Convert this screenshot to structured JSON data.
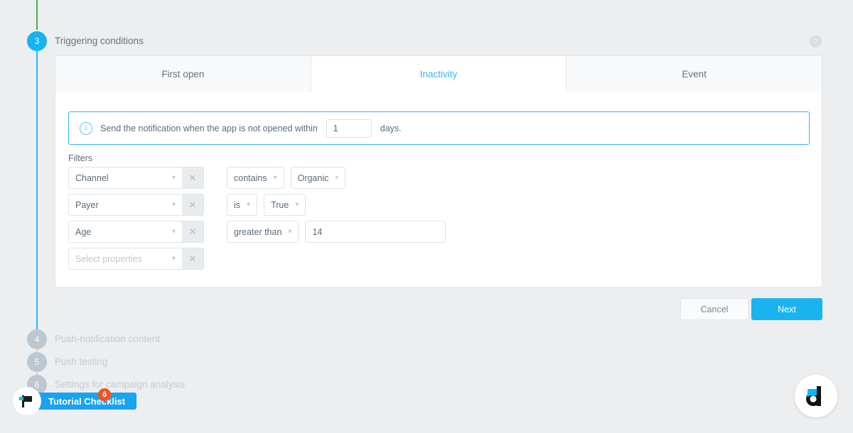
{
  "section": {
    "step_number": "3",
    "title": "Triggering conditions",
    "help_icon": "question-mark-icon"
  },
  "tabs": [
    {
      "label": "First open",
      "active": false
    },
    {
      "label": "Inactivity",
      "active": true
    },
    {
      "label": "Event",
      "active": false
    }
  ],
  "info_banner": {
    "icon": "info-circle-icon",
    "text": "Send the notification when the app is not opened within",
    "days_value": "1",
    "days_placeholder": "1",
    "suffix": "days."
  },
  "filters": {
    "label": "Filters",
    "property_placeholder": "Select properties",
    "remove_icon": "close-icon",
    "chevron_icon": "chevron-down-icon",
    "rows": [
      {
        "property": "Channel",
        "operator": "contains",
        "value": "Organic",
        "value_type": "select"
      },
      {
        "property": "Payer",
        "operator": "is",
        "value": "True",
        "value_type": "select"
      },
      {
        "property": "Age",
        "operator": "greater than",
        "value": "14",
        "value_type": "input"
      },
      {
        "property": "",
        "operator": "",
        "value": "",
        "value_type": "none"
      }
    ]
  },
  "footer": {
    "cancel_label": "Cancel",
    "next_label": "Next"
  },
  "remaining_steps": [
    {
      "number": "4",
      "label": "Push-notification content"
    },
    {
      "number": "5",
      "label": "Push testing"
    },
    {
      "number": "6",
      "label": "Settings for campaign analysis"
    }
  ],
  "tutorial_checklist": {
    "label": "Tutorial Checklist",
    "badge_count": "6",
    "icon": "flag-icon"
  },
  "launcher": {
    "icon": "devtodev-d-logo-icon"
  },
  "colors": {
    "accent_cyan": "#19b4f0",
    "tab_active_text": "#3ab6f2",
    "badge_orange": "#f4511e",
    "rail_green": "#4caf50",
    "step_pending_gray": "#bdc7cf",
    "page_background": "#eceef0"
  }
}
